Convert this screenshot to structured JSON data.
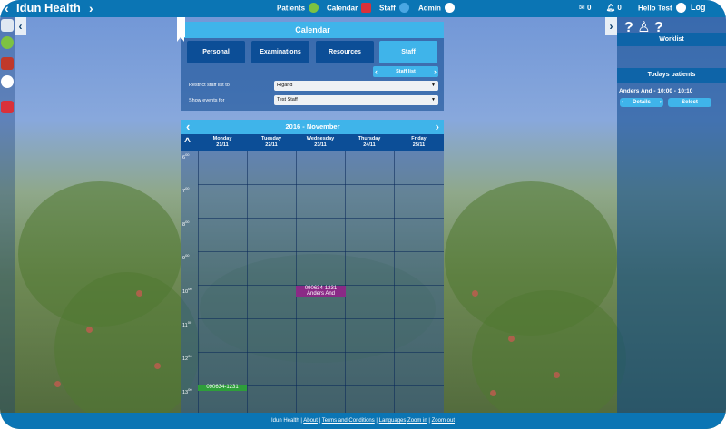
{
  "header": {
    "brand": "Idun Health",
    "nav": [
      {
        "label": "Patients",
        "icon": "user-icon"
      },
      {
        "label": "Calendar",
        "icon": "calendar-icon"
      },
      {
        "label": "Staff",
        "icon": "staff-icon"
      },
      {
        "label": "Admin",
        "icon": "gear-icon"
      }
    ],
    "mail_count": "0",
    "bell_count": "0",
    "greeting": "Hello Test",
    "logout": "Log"
  },
  "calendar_panel": {
    "title": "Calendar",
    "tabs": [
      "Personal",
      "Examinations",
      "Resources",
      "Staff"
    ],
    "active_tab": "Staff",
    "staff_list_label": "Staff list",
    "restrict_label": "Restrict staff list to",
    "restrict_value": "Rigand",
    "show_events_label": "Show events for",
    "show_events_value": "Test Staff"
  },
  "week": {
    "month_label": "2016 - November",
    "days": [
      {
        "name": "Monday",
        "date": "21/11"
      },
      {
        "name": "Tuesday",
        "date": "22/11"
      },
      {
        "name": "Wednesday",
        "date": "23/11"
      },
      {
        "name": "Thursday",
        "date": "24/11"
      },
      {
        "name": "Friday",
        "date": "25/11"
      }
    ],
    "hours": [
      {
        "h": "6",
        "m": "00"
      },
      {
        "h": "7",
        "m": "00"
      },
      {
        "h": "8",
        "m": "00"
      },
      {
        "h": "9",
        "m": "00"
      },
      {
        "h": "10",
        "m": "00"
      },
      {
        "h": "11",
        "m": "00"
      },
      {
        "h": "12",
        "m": "00"
      },
      {
        "h": "13",
        "m": "00"
      }
    ],
    "events": [
      {
        "line1": "090634-1231",
        "line2": "Anders And",
        "color": "#8a2a86"
      },
      {
        "line1": "090634-1231",
        "line2": "",
        "color": "#2e9e3a"
      }
    ]
  },
  "worklist": {
    "title": "Worklist",
    "today_title": "Todays patients",
    "patient": "Anders And - 10:00 - 10:10",
    "details_label": "Details",
    "select_label": "Select"
  },
  "footer": {
    "brand": "Idun Health",
    "links": [
      "About",
      "Terms and Conditions",
      "Languages",
      "Zoom in",
      "Zoom out"
    ]
  },
  "colors": {
    "topbar": "#0b75b4",
    "accent": "#3fb4ea",
    "navy": "#0c4e97"
  }
}
